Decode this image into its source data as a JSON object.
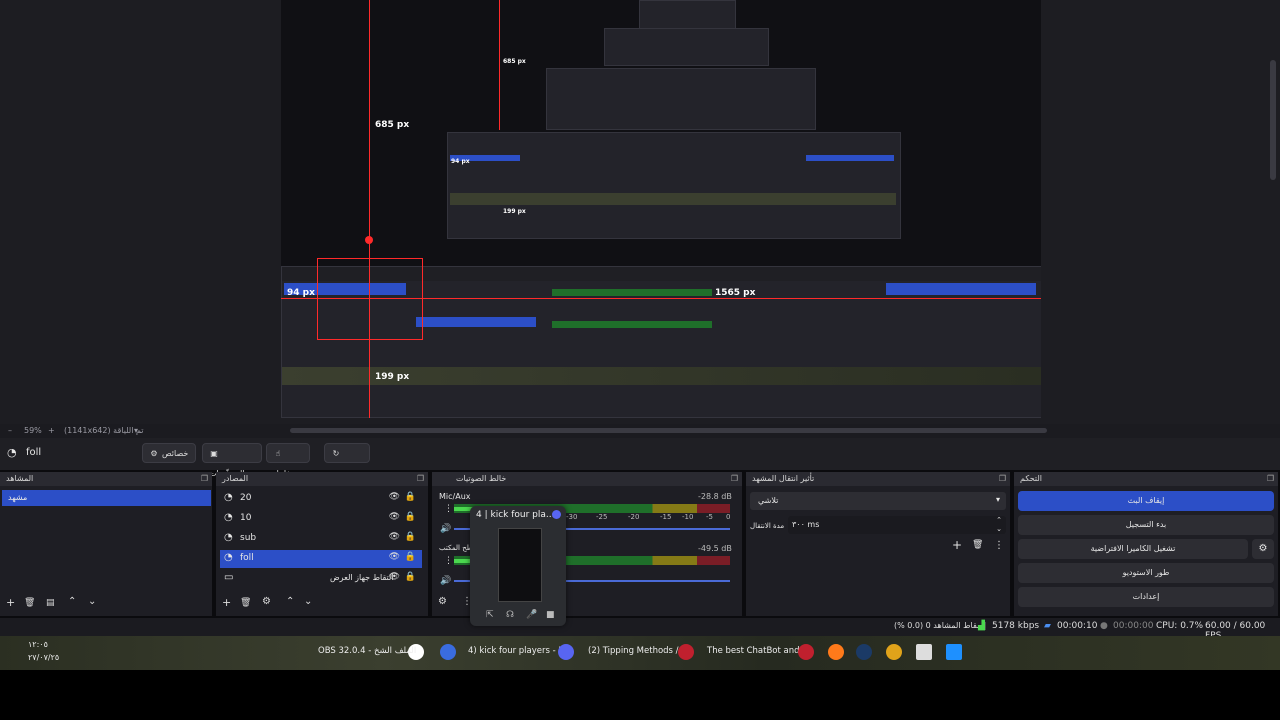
{
  "preview": {
    "measure_top": "685 px",
    "measure_left": "94 px",
    "measure_right": "1565 px",
    "measure_bottom": "199 px",
    "nested_measure_mid": "685 px",
    "nested_left": "94 px",
    "nested_bottom": "199 px"
  },
  "zoombar": {
    "zoom": "59%",
    "plus": "+",
    "resolution": "(1141x642) تم اللياقة"
  },
  "toolbar": {
    "scene_icon": "scene-icon",
    "scene_name": "foll",
    "properties": "خصائص",
    "filters": "المرشّحات",
    "interact": "تفاعل",
    "refresh": "تحديث"
  },
  "scenes": {
    "title": "المشاهد",
    "items": [
      "مشهد"
    ]
  },
  "sources": {
    "title": "المصادر",
    "items": [
      {
        "name": "20",
        "selected": false,
        "type_icon": "browser-icon"
      },
      {
        "name": "10",
        "selected": false,
        "type_icon": "browser-icon"
      },
      {
        "name": "sub",
        "selected": false,
        "type_icon": "browser-icon"
      },
      {
        "name": "foll",
        "selected": true,
        "type_icon": "browser-icon"
      },
      {
        "name": "التقاط جهاز العرض",
        "selected": false,
        "type_icon": "display-icon"
      }
    ]
  },
  "mixer": {
    "title": "خالط الصوتيات",
    "channels": [
      {
        "name": "Mic/Aux",
        "db": "-28.8 dB",
        "level": 0.38
      },
      {
        "name": "صوت سطح المكتب",
        "db": "-49.5 dB",
        "level": 0.2
      }
    ],
    "scale": [
      "-35",
      "-30",
      "-25",
      "-20",
      "-15",
      "-10",
      "-5",
      "0"
    ]
  },
  "transitions": {
    "title": "تأثير انتقال المشهد",
    "type": "تلاشي",
    "duration_label": "مدة الانتقال",
    "duration": "٣٠٠ ms"
  },
  "controls": {
    "title": "التحكم",
    "stop_stream": "إيقاف البث",
    "start_recording": "بدء التسجيل",
    "virtual_camera": "تشغيل الكاميرا الافتراضية",
    "studio_mode": "طور الاستوديو",
    "settings": "إعدادات"
  },
  "statusbar": {
    "dropped": "إسقاط المشاهد 0 (0.0 %)",
    "bitrate": "5178 kbps",
    "stream_time": "00:00:10",
    "rec_time": "00:00:00",
    "cpu": "CPU: 0.7%",
    "fps": "60.00 / 60.00 FPS"
  },
  "taskbar": {
    "clock": "١٢:٠٥",
    "date": "٢٧/٠٧/٢٥",
    "tasks": [
      "OBS 32.0.4 - الملف الشخ",
      "4) kick four players - Di",
      "(2) Tipping Methods / S",
      "The best ChatBot and W"
    ]
  },
  "popup": {
    "title": "4 | kick four pla..."
  },
  "colors": {
    "accent": "#2c4fc7",
    "red_guide": "#ff2a2a"
  }
}
